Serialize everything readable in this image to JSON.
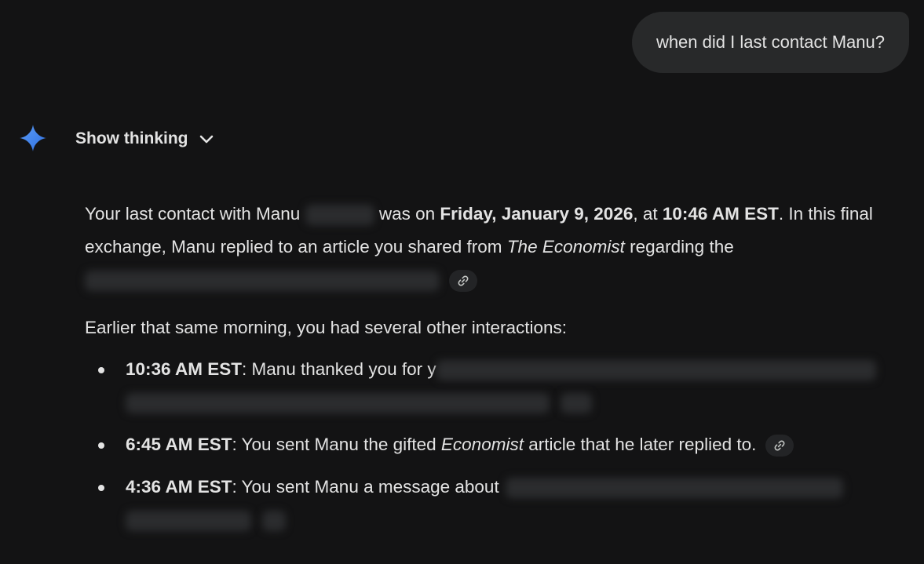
{
  "user_message": {
    "text": "when did I last contact Manu?"
  },
  "thinking": {
    "label": "Show thinking",
    "icon": "chevron-down-icon"
  },
  "assistant": {
    "icon": "gemini-sparkle-icon",
    "accent_color": "#4b8ef5",
    "paragraph1": {
      "t1": "Your last contact with Manu ",
      "t2": " was on ",
      "date": "Friday, January 9, 2026",
      "t3": ", at ",
      "time": "10:46 AM EST",
      "t4": ". In this final exchange, Manu replied to an article you shared from ",
      "publication": "The Economist",
      "t5": " regarding the"
    },
    "paragraph2": "Earlier that same morning, you had several other interactions:",
    "bullets": [
      {
        "time": "10:36 AM EST",
        "text": ": Manu thanked you for ",
        "tail": "y"
      },
      {
        "time": "6:45 AM EST",
        "text1": ": You sent Manu the gifted ",
        "publication": "Economist",
        "text2": " article that he later replied to."
      },
      {
        "time": "4:36 AM EST",
        "text": ": You sent Manu a message about"
      }
    ]
  }
}
